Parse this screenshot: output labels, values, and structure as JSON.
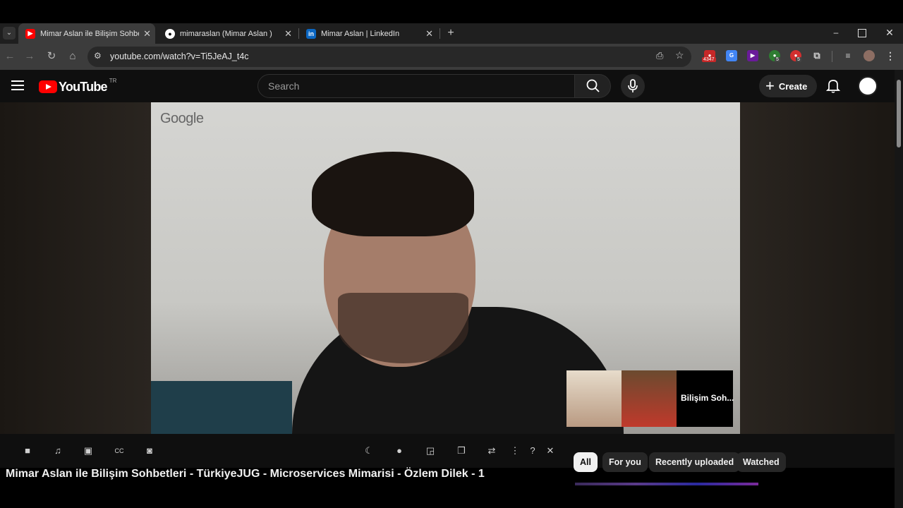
{
  "tabs": [
    {
      "title": "Mimar Aslan ile Bilişim Sohbetleri",
      "active": true,
      "favicon": "youtube-icon"
    },
    {
      "title": "mimaraslan (Mimar Aslan )",
      "active": false,
      "favicon": "github-icon"
    },
    {
      "title": "Mimar Aslan | LinkedIn",
      "active": false,
      "favicon": "linkedin-icon"
    }
  ],
  "omnibox": {
    "url": "youtube.com/watch?v=Ti5JeAJ_t4c"
  },
  "extensions": {
    "badge_1": "4347",
    "badge_2": "5",
    "badge_3": "5"
  },
  "youtube": {
    "logo_text": "YouTube",
    "region": "TR",
    "search_placeholder": "Search",
    "create_label": "Create"
  },
  "video": {
    "watermark": "Google",
    "pip_name": "Bilişim Soh..."
  },
  "chips": [
    {
      "label": "All",
      "selected": true
    },
    {
      "label": "For you",
      "selected": false
    },
    {
      "label": "Recently uploaded",
      "selected": false
    },
    {
      "label": "Watched",
      "selected": false
    }
  ],
  "video_title": "Mimar Aslan ile Bilişim Sohbetleri - TürkiyeJUG - Microservices Mimarisi - Özlem Dilek - 1",
  "colors": {
    "youtube_red": "#ff0000",
    "background": "#0f0f0f"
  }
}
